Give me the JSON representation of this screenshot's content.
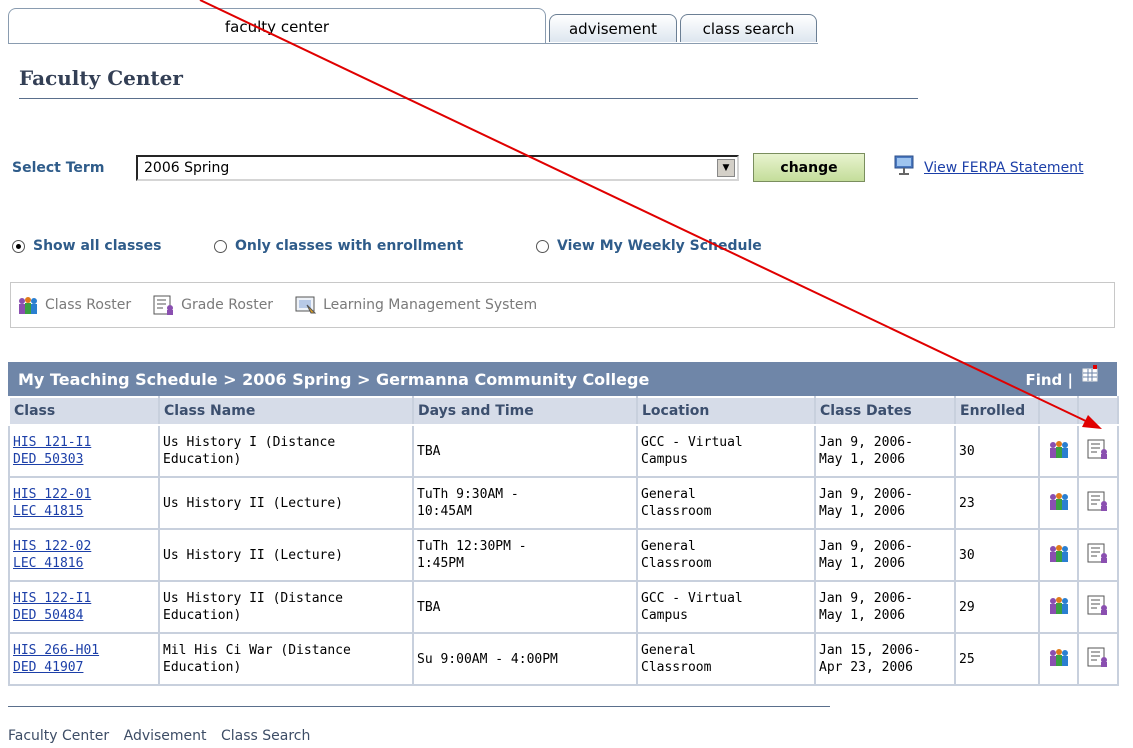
{
  "tabs": {
    "faculty_center": "faculty center",
    "advisement": "advisement",
    "class_search": "class search"
  },
  "page": {
    "title": "Faculty Center"
  },
  "term": {
    "label": "Select Term",
    "selected": "2006 Spring",
    "change_label": "change",
    "ferpa_label": "View FERPA Statement"
  },
  "view_options": {
    "show_all": "Show all classes",
    "only_enrolled": "Only classes with enrollment",
    "weekly": "View My Weekly Schedule",
    "selected": "show_all"
  },
  "toolbar": {
    "class_roster": "Class Roster",
    "grade_roster": "Grade Roster",
    "lms": "Learning Management System"
  },
  "grid": {
    "title": "My Teaching Schedule > 2006 Spring > Germanna Community College",
    "find": "Find |",
    "headers": [
      "Class",
      "Class Name",
      "Days and Time",
      "Location",
      "Class Dates",
      "Enrolled"
    ],
    "rows": [
      {
        "class1": "HIS 121-I1",
        "class2": "DED 50303",
        "name1": "Us History I (Distance",
        "name2": "Education)",
        "time1": "TBA",
        "time2": "",
        "loc1": "GCC - Virtual",
        "loc2": "Campus",
        "date1": "Jan 9, 2006-",
        "date2": "May 1, 2006",
        "enrolled": "30"
      },
      {
        "class1": "HIS 122-01",
        "class2": "LEC 41815",
        "name1": "Us History II (Lecture)",
        "name2": "",
        "time1": "TuTh 9:30AM -",
        "time2": "10:45AM",
        "loc1": "General",
        "loc2": "Classroom",
        "date1": "Jan 9, 2006-",
        "date2": "May 1, 2006",
        "enrolled": "23"
      },
      {
        "class1": "HIS 122-02",
        "class2": "LEC 41816",
        "name1": "Us History II (Lecture)",
        "name2": "",
        "time1": "TuTh 12:30PM -",
        "time2": "1:45PM",
        "loc1": "General",
        "loc2": "Classroom",
        "date1": "Jan 9, 2006-",
        "date2": "May 1, 2006",
        "enrolled": "30"
      },
      {
        "class1": "HIS 122-I1",
        "class2": "DED 50484",
        "name1": "Us History II (Distance",
        "name2": "Education)",
        "time1": "TBA",
        "time2": "",
        "loc1": "GCC - Virtual",
        "loc2": "Campus",
        "date1": "Jan 9, 2006-",
        "date2": "May 1, 2006",
        "enrolled": "29"
      },
      {
        "class1": "HIS 266-H01",
        "class2": "DED 41907",
        "name1": "Mil His Ci War (Distance",
        "name2": "Education)",
        "time1": "Su 9:00AM - 4:00PM",
        "time2": "",
        "loc1": "General",
        "loc2": "Classroom",
        "date1": "Jan 15, 2006-",
        "date2": "Apr 23, 2006",
        "enrolled": "25"
      }
    ]
  },
  "footer": {
    "links": [
      "Faculty Center",
      "Advisement",
      "Class Search"
    ]
  },
  "colors": {
    "grid_header": "#6f86a8",
    "link": "#1c3fa8",
    "annotation_arrow": "#e00000"
  }
}
